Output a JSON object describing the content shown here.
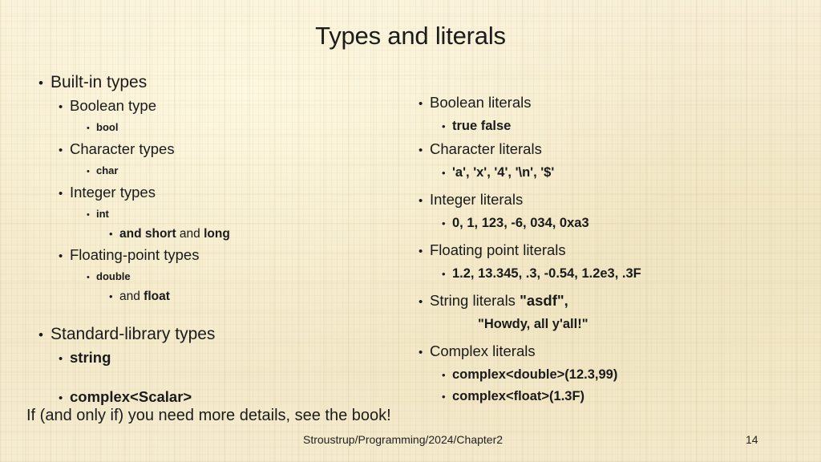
{
  "slide": {
    "title": "Types and literals",
    "bottom_note": "If (and only if) you need more details, see the book!",
    "footer": {
      "attribution": "Stroustrup/Programming/2024/Chapter2",
      "page_number": "14"
    },
    "bullet_glyph": "•",
    "background_color": "#f4ead0",
    "text_color": "#1a1a1a"
  },
  "left_column": {
    "heading1": "Built-in types",
    "boolean_type": "Boolean type",
    "bool_code": "bool",
    "character_types": "Character types",
    "char_code": "char",
    "integer_types": "Integer types",
    "int_code": "int",
    "and_short_bold": "and short",
    "and_plain": " and ",
    "long_bold": "long",
    "floating_point_types": "Floating-point types",
    "double_code": "double",
    "and_plain2": "and ",
    "float_bold": "float",
    "heading2": "Standard-library types",
    "string_code": "string",
    "complex_scalar_code": "complex<Scalar>"
  },
  "right_column": {
    "boolean_literals": "Boolean literals",
    "boolean_values": "true false",
    "character_literals": "Character literals",
    "character_values": "'a', 'x', '4', '\\n', '$'",
    "integer_literals": "Integer literals",
    "integer_values": "0, 1, 123, -6, 034, 0xa3",
    "floating_point_literals": "Floating point literals",
    "floating_point_values": "1.2, 13.345, .3, -0.54, 1.2e3, .3F",
    "string_literals_label": "String literals ",
    "string_literals_value1": "\"asdf\",",
    "string_literals_value2": "\"Howdy, all y'all!\"",
    "complex_literals": "Complex literals",
    "complex_double_value": "complex<double>(12.3,99)",
    "complex_float_value": "complex<float>(1.3F)"
  }
}
